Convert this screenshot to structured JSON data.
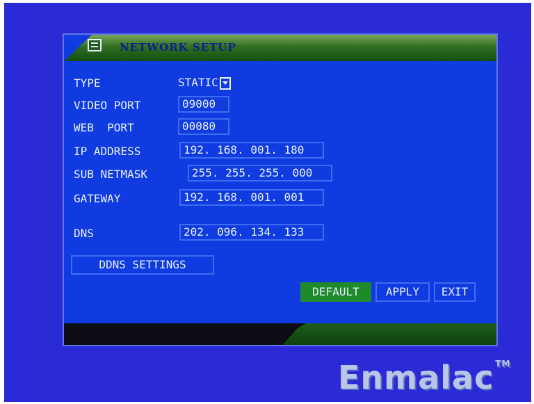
{
  "dialog": {
    "title": "NETWORK SETUP"
  },
  "fields": {
    "type": {
      "label": "TYPE",
      "value": "STATIC"
    },
    "video_port": {
      "label": "VIDEO PORT",
      "value": "09000"
    },
    "web_port": {
      "label": "WEB  PORT",
      "value": "00080"
    },
    "ip_address": {
      "label": "IP ADDRESS",
      "value": "192. 168. 001. 180"
    },
    "sub_netmask": {
      "label": "SUB NETMASK",
      "value": "255. 255. 255. 000"
    },
    "gateway": {
      "label": "GATEWAY",
      "value": "192. 168. 001. 001"
    },
    "dns": {
      "label": "DNS",
      "value": "202. 096. 134. 133"
    }
  },
  "buttons": {
    "ddns_settings": "DDNS SETTINGS",
    "default": "DEFAULT",
    "apply": "APPLY",
    "exit": "EXIT"
  },
  "watermark": {
    "text": "Enmalac",
    "mark": "TM"
  },
  "colors": {
    "background": "#2a2ad6",
    "dialog_fill": "#0f3be0",
    "field_border": "#3f6df0",
    "active_button": "#1f8a2a",
    "title_green": "#2f6f22"
  }
}
